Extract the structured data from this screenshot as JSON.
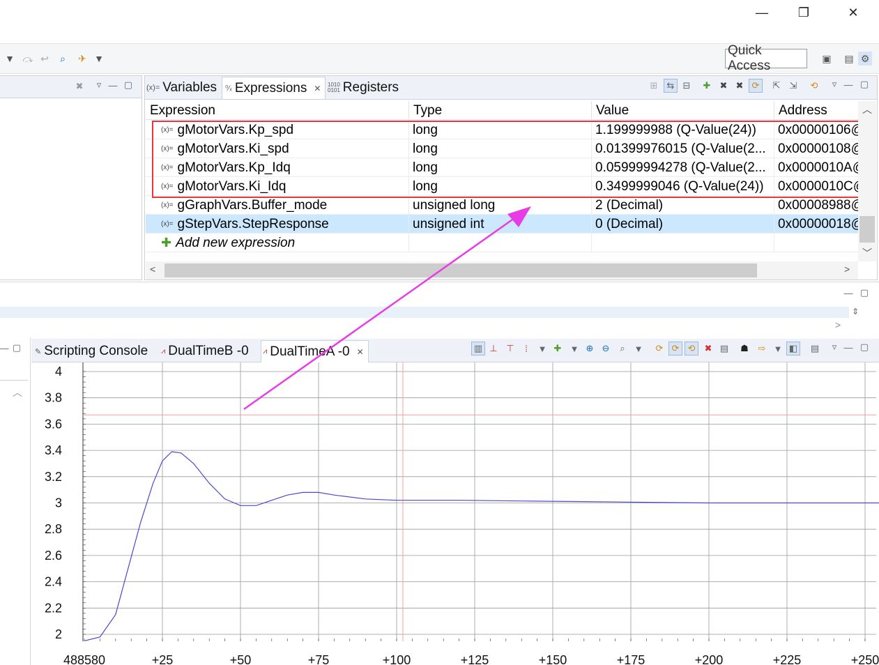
{
  "quick_access": "Quick Access",
  "top_view": {
    "tabs": [
      {
        "label": "Variables",
        "icon": "variables-icon"
      },
      {
        "label": "Expressions",
        "icon": "expressions-icon"
      },
      {
        "label": "Registers",
        "icon": "registers-icon"
      }
    ],
    "columns": [
      "Expression",
      "Type",
      "Value",
      "Address"
    ],
    "rows": [
      {
        "expression": "gMotorVars.Kp_spd",
        "type": "long",
        "value": "1.199999988 (Q-Value(24))",
        "address": "0x00000106@"
      },
      {
        "expression": "gMotorVars.Ki_spd",
        "type": "long",
        "value": "0.01399976015 (Q-Value(2...",
        "address": "0x00000108@"
      },
      {
        "expression": "gMotorVars.Kp_Idq",
        "type": "long",
        "value": "0.05999994278 (Q-Value(2...",
        "address": "0x0000010A@"
      },
      {
        "expression": "gMotorVars.Ki_Idq",
        "type": "long",
        "value": "0.3499999046 (Q-Value(24))",
        "address": "0x0000010C@"
      },
      {
        "expression": "gGraphVars.Buffer_mode",
        "type": "unsigned long",
        "value": "2 (Decimal)",
        "address": "0x00008988@"
      },
      {
        "expression": "gStepVars.StepResponse",
        "type": "unsigned int",
        "value": "0 (Decimal)",
        "address": "0x00000018@"
      }
    ],
    "add_new": "Add new expression",
    "selected_row": 5
  },
  "bottom_view": {
    "tabs": [
      {
        "label": "Scripting Console",
        "icon": "console-icon"
      },
      {
        "label": "DualTimeB -0",
        "icon": "graph-icon"
      },
      {
        "label": "DualTimeA -0",
        "icon": "graph-icon"
      }
    ]
  },
  "colors": {
    "accent_highlight": "#e8373b",
    "arrow": "#e83be8",
    "trace": "#4a4acf",
    "cursor": "#f0a0a0"
  },
  "chart_data": {
    "type": "line",
    "y_ticks": [
      "4",
      "3.8",
      "3.6",
      "3.4",
      "3.2",
      "3",
      "2.8",
      "2.6",
      "2.4",
      "2.2",
      "2"
    ],
    "x_ticks": [
      "488580",
      "+25",
      "+50",
      "+75",
      "+100",
      "+125",
      "+150",
      "+175",
      "+200",
      "+225",
      "+250"
    ],
    "xlim": [
      0,
      255
    ],
    "ylim": [
      1.95,
      4.05
    ],
    "grid": true,
    "h_cursor_y": 3.67,
    "v_cursor_x": 102,
    "series": [
      {
        "points": [
          [
            0,
            1.95
          ],
          [
            5,
            1.98
          ],
          [
            10,
            2.15
          ],
          [
            14,
            2.5
          ],
          [
            18,
            2.85
          ],
          [
            22,
            3.15
          ],
          [
            25,
            3.32
          ],
          [
            28,
            3.39
          ],
          [
            31,
            3.38
          ],
          [
            35,
            3.3
          ],
          [
            40,
            3.15
          ],
          [
            45,
            3.03
          ],
          [
            50,
            2.98
          ],
          [
            55,
            2.98
          ],
          [
            60,
            3.02
          ],
          [
            65,
            3.06
          ],
          [
            70,
            3.08
          ],
          [
            75,
            3.08
          ],
          [
            80,
            3.06
          ],
          [
            90,
            3.03
          ],
          [
            100,
            3.02
          ],
          [
            120,
            3.02
          ],
          [
            140,
            3.015
          ],
          [
            160,
            3.01
          ],
          [
            180,
            3.005
          ],
          [
            200,
            3.0
          ],
          [
            220,
            3.0
          ],
          [
            240,
            3.0
          ],
          [
            255,
            3.0
          ]
        ]
      }
    ]
  }
}
